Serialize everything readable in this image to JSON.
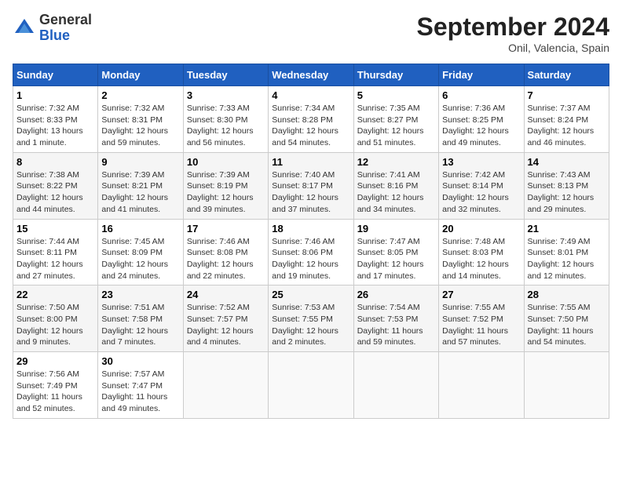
{
  "header": {
    "logo_general": "General",
    "logo_blue": "Blue",
    "title": "September 2024",
    "subtitle": "Onil, Valencia, Spain"
  },
  "days_of_week": [
    "Sunday",
    "Monday",
    "Tuesday",
    "Wednesday",
    "Thursday",
    "Friday",
    "Saturday"
  ],
  "weeks": [
    [
      {
        "day": "1",
        "info": "Sunrise: 7:32 AM\nSunset: 8:33 PM\nDaylight: 13 hours\nand 1 minute."
      },
      {
        "day": "2",
        "info": "Sunrise: 7:32 AM\nSunset: 8:31 PM\nDaylight: 12 hours\nand 59 minutes."
      },
      {
        "day": "3",
        "info": "Sunrise: 7:33 AM\nSunset: 8:30 PM\nDaylight: 12 hours\nand 56 minutes."
      },
      {
        "day": "4",
        "info": "Sunrise: 7:34 AM\nSunset: 8:28 PM\nDaylight: 12 hours\nand 54 minutes."
      },
      {
        "day": "5",
        "info": "Sunrise: 7:35 AM\nSunset: 8:27 PM\nDaylight: 12 hours\nand 51 minutes."
      },
      {
        "day": "6",
        "info": "Sunrise: 7:36 AM\nSunset: 8:25 PM\nDaylight: 12 hours\nand 49 minutes."
      },
      {
        "day": "7",
        "info": "Sunrise: 7:37 AM\nSunset: 8:24 PM\nDaylight: 12 hours\nand 46 minutes."
      }
    ],
    [
      {
        "day": "8",
        "info": "Sunrise: 7:38 AM\nSunset: 8:22 PM\nDaylight: 12 hours\nand 44 minutes."
      },
      {
        "day": "9",
        "info": "Sunrise: 7:39 AM\nSunset: 8:21 PM\nDaylight: 12 hours\nand 41 minutes."
      },
      {
        "day": "10",
        "info": "Sunrise: 7:39 AM\nSunset: 8:19 PM\nDaylight: 12 hours\nand 39 minutes."
      },
      {
        "day": "11",
        "info": "Sunrise: 7:40 AM\nSunset: 8:17 PM\nDaylight: 12 hours\nand 37 minutes."
      },
      {
        "day": "12",
        "info": "Sunrise: 7:41 AM\nSunset: 8:16 PM\nDaylight: 12 hours\nand 34 minutes."
      },
      {
        "day": "13",
        "info": "Sunrise: 7:42 AM\nSunset: 8:14 PM\nDaylight: 12 hours\nand 32 minutes."
      },
      {
        "day": "14",
        "info": "Sunrise: 7:43 AM\nSunset: 8:13 PM\nDaylight: 12 hours\nand 29 minutes."
      }
    ],
    [
      {
        "day": "15",
        "info": "Sunrise: 7:44 AM\nSunset: 8:11 PM\nDaylight: 12 hours\nand 27 minutes."
      },
      {
        "day": "16",
        "info": "Sunrise: 7:45 AM\nSunset: 8:09 PM\nDaylight: 12 hours\nand 24 minutes."
      },
      {
        "day": "17",
        "info": "Sunrise: 7:46 AM\nSunset: 8:08 PM\nDaylight: 12 hours\nand 22 minutes."
      },
      {
        "day": "18",
        "info": "Sunrise: 7:46 AM\nSunset: 8:06 PM\nDaylight: 12 hours\nand 19 minutes."
      },
      {
        "day": "19",
        "info": "Sunrise: 7:47 AM\nSunset: 8:05 PM\nDaylight: 12 hours\nand 17 minutes."
      },
      {
        "day": "20",
        "info": "Sunrise: 7:48 AM\nSunset: 8:03 PM\nDaylight: 12 hours\nand 14 minutes."
      },
      {
        "day": "21",
        "info": "Sunrise: 7:49 AM\nSunset: 8:01 PM\nDaylight: 12 hours\nand 12 minutes."
      }
    ],
    [
      {
        "day": "22",
        "info": "Sunrise: 7:50 AM\nSunset: 8:00 PM\nDaylight: 12 hours\nand 9 minutes."
      },
      {
        "day": "23",
        "info": "Sunrise: 7:51 AM\nSunset: 7:58 PM\nDaylight: 12 hours\nand 7 minutes."
      },
      {
        "day": "24",
        "info": "Sunrise: 7:52 AM\nSunset: 7:57 PM\nDaylight: 12 hours\nand 4 minutes."
      },
      {
        "day": "25",
        "info": "Sunrise: 7:53 AM\nSunset: 7:55 PM\nDaylight: 12 hours\nand 2 minutes."
      },
      {
        "day": "26",
        "info": "Sunrise: 7:54 AM\nSunset: 7:53 PM\nDaylight: 11 hours\nand 59 minutes."
      },
      {
        "day": "27",
        "info": "Sunrise: 7:55 AM\nSunset: 7:52 PM\nDaylight: 11 hours\nand 57 minutes."
      },
      {
        "day": "28",
        "info": "Sunrise: 7:55 AM\nSunset: 7:50 PM\nDaylight: 11 hours\nand 54 minutes."
      }
    ],
    [
      {
        "day": "29",
        "info": "Sunrise: 7:56 AM\nSunset: 7:49 PM\nDaylight: 11 hours\nand 52 minutes."
      },
      {
        "day": "30",
        "info": "Sunrise: 7:57 AM\nSunset: 7:47 PM\nDaylight: 11 hours\nand 49 minutes."
      },
      null,
      null,
      null,
      null,
      null
    ]
  ]
}
